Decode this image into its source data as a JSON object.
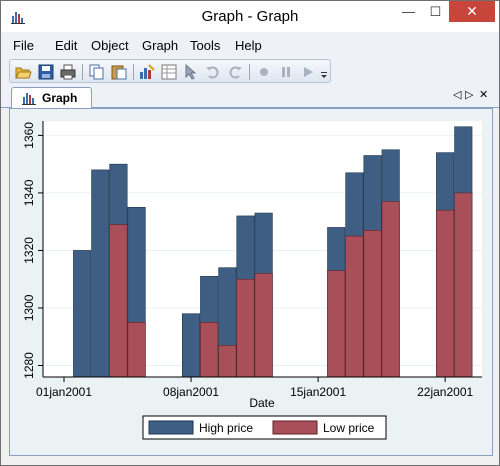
{
  "window": {
    "title": "Graph - Graph",
    "minimize_label": "—",
    "maximize_label": "☐",
    "close_label": "✕"
  },
  "menu": {
    "items": [
      "File",
      "Edit",
      "Object",
      "Graph",
      "Tools",
      "Help"
    ]
  },
  "toolbar": {
    "buttons": [
      "open-icon",
      "save-icon",
      "print-icon",
      "copy-icon",
      "paste-icon",
      "graph-editor-icon",
      "data-editor-icon",
      "pointer-icon",
      "undo-icon",
      "redo-icon",
      "record-icon",
      "pause-icon",
      "play-icon"
    ]
  },
  "tabs": {
    "active": "Graph",
    "controls": [
      "◁",
      "▷",
      "✕"
    ]
  },
  "colors": {
    "high_price": "#3e5f83",
    "low_price": "#a84f59",
    "close_button": "#c7453a"
  },
  "chart_data": {
    "type": "bar",
    "xlabel": "Date",
    "ylabel": "",
    "xticks": [
      "01jan2001",
      "08jan2001",
      "15jan2001",
      "22jan2001"
    ],
    "yticks": [
      1280,
      1300,
      1320,
      1340,
      1360
    ],
    "ylim": [
      1276,
      1365
    ],
    "grid": true,
    "legend_position": "bottom",
    "x": [
      "02jan2001",
      "03jan2001",
      "04jan2001",
      "05jan2001",
      "08jan2001",
      "09jan2001",
      "10jan2001",
      "11jan2001",
      "12jan2001",
      "16jan2001",
      "17jan2001",
      "18jan2001",
      "19jan2001",
      "22jan2001",
      "23jan2001"
    ],
    "x_index": [
      1,
      2,
      3,
      4,
      7,
      8,
      9,
      10,
      11,
      15,
      16,
      17,
      18,
      21,
      22
    ],
    "series": [
      {
        "name": "High price",
        "values": [
          1320,
          1348,
          1350,
          1335,
          1298,
          1311,
          1314,
          1332,
          1333,
          1328,
          1347,
          1353,
          1355,
          1354,
          1363
        ]
      },
      {
        "name": "Low price",
        "values": [
          1276,
          1275,
          1329,
          1295,
          1276,
          1295,
          1287,
          1310,
          1312,
          1313,
          1325,
          1327,
          1337,
          1334,
          1340
        ]
      }
    ]
  }
}
